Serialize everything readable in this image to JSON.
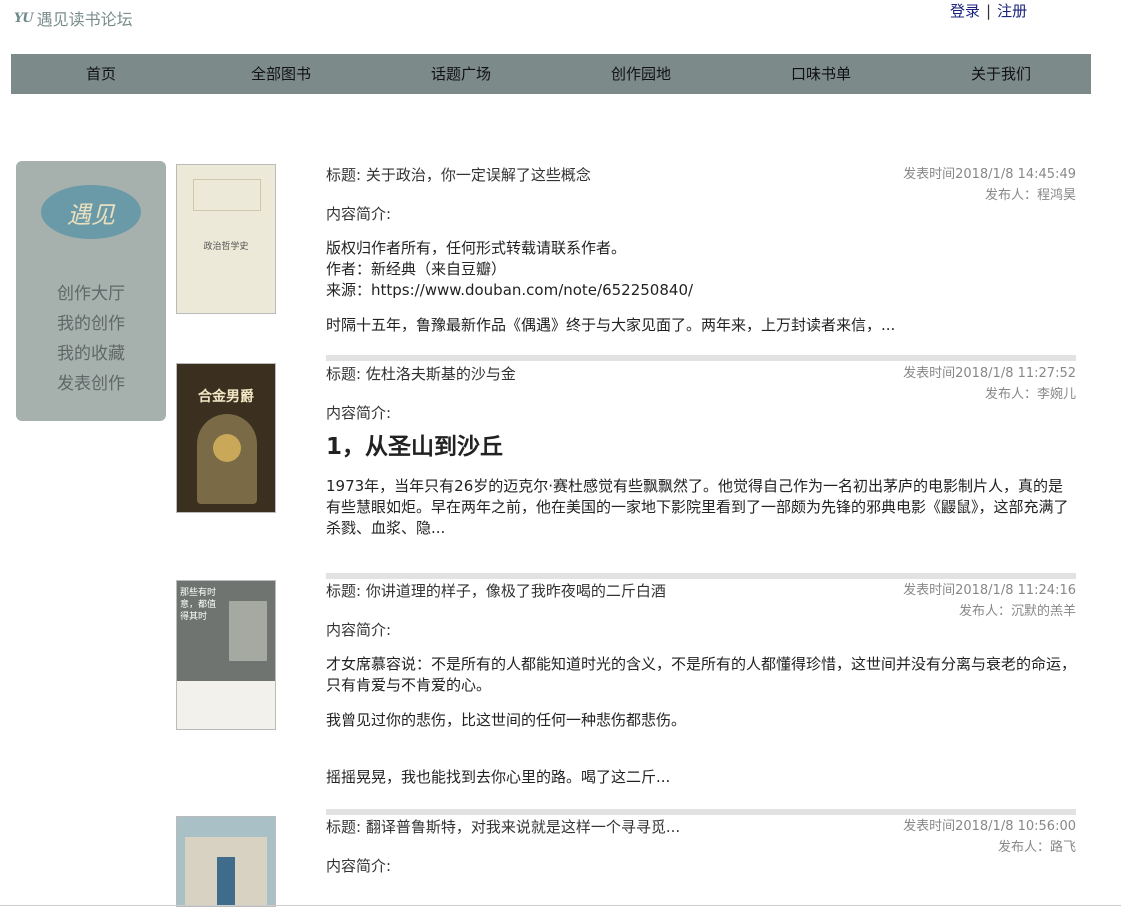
{
  "brand": {
    "mark": "YU",
    "name": "遇见读书论坛"
  },
  "auth": {
    "login": "登录",
    "separator": "|",
    "register": "注册"
  },
  "nav": [
    "首页",
    "全部图书",
    "话题广场",
    "创作园地",
    "口味书单",
    "关于我们"
  ],
  "sidebar": {
    "badge": "遇见",
    "links": [
      "创作大厅",
      "我的创作",
      "我的收藏",
      "发表创作"
    ]
  },
  "labels": {
    "intro": "内容简介:"
  },
  "posts": [
    {
      "title": "标题: 关于政治，你一定误解了这些概念",
      "time": "发表时间2018/1/8 14:45:49",
      "author": "发布人：程鸿昊",
      "cover": "政治哲学史",
      "lines": [
        "版权归作者所有，任何形式转载请联系作者。",
        "作者：新经典（来自豆瓣）",
        "来源：https://www.douban.com/note/652250840/"
      ],
      "excerpt": "时隔十五年，鲁豫最新作品《偶遇》终于与大家见面了。两年来，上万封读者来信，..."
    },
    {
      "title": "标题: 佐杜洛夫斯基的沙与金",
      "time": "发表时间2018/1/8 11:27:52",
      "author": "发布人：李婉儿",
      "cover": "合金男爵",
      "heading": "1，从圣山到沙丘",
      "excerpt": "1973年，当年只有26岁的迈克尔·赛杜感觉有些飘飘然了。他觉得自己作为一名初出茅庐的电影制片人，真的是有些慧眼如炬。早在两年之前，他在美国的一家地下影院里看到了一部颇为先锋的邪典电影《鼹鼠》，这部充满了杀戮、血浆、隐..."
    },
    {
      "title": "标题: 你讲道理的样子，像极了我昨夜喝的二斤白酒",
      "time": "发表时间2018/1/8 11:24:16",
      "author": "发布人：沉默的羔羊",
      "cover": "那些有时意，都值得其时",
      "p1": "才女席慕容说：不是所有的人都能知道时光的含义，不是所有的人都懂得珍惜，这世间并没有分离与衰老的命运，只有肯爱与不肯爱的心。",
      "p2": "我曾见过你的悲伤，比这世间的任何一种悲伤都悲伤。",
      "excerpt": "摇摇晃晃，我也能找到去你心里的路。喝了这二斤..."
    },
    {
      "title": "标题: 翻译普鲁斯特，对我来说就是这样一个寻寻觅...",
      "time": "发表时间2018/1/8 10:56:00",
      "author": "发布人：路飞"
    }
  ],
  "colors": {
    "nav": "#7d8a8a",
    "sidebar": "#a6b1ae",
    "badge": "#6a9aa8",
    "link": "#1a237e"
  }
}
